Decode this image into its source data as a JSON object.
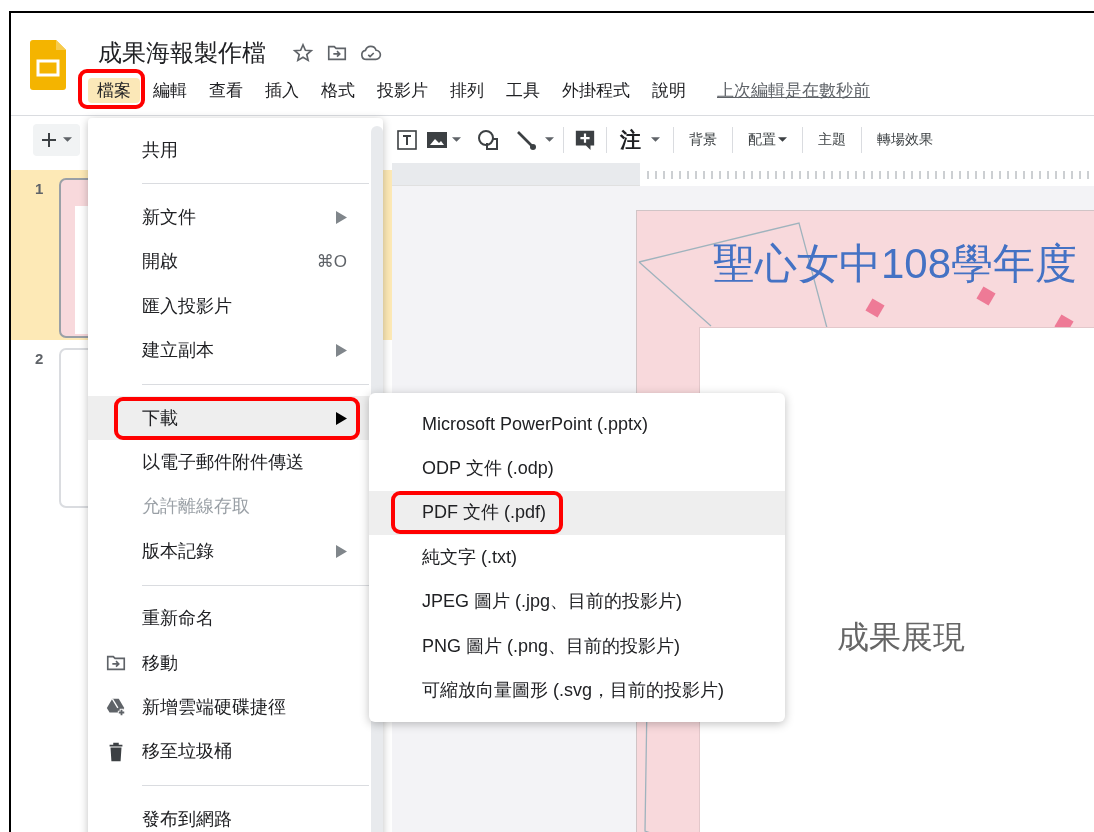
{
  "app": {
    "title": "成果海報製作檔"
  },
  "menubar": [
    {
      "label": "檔案",
      "selected": true,
      "annotated": true
    },
    {
      "label": "編輯",
      "selected": false,
      "annotated": false
    },
    {
      "label": "查看",
      "selected": false,
      "annotated": false
    },
    {
      "label": "插入",
      "selected": false,
      "annotated": false
    },
    {
      "label": "格式",
      "selected": false,
      "annotated": false
    },
    {
      "label": "投影片",
      "selected": false,
      "annotated": false
    },
    {
      "label": "排列",
      "selected": false,
      "annotated": false
    },
    {
      "label": "工具",
      "selected": false,
      "annotated": false
    },
    {
      "label": "外掛程式",
      "selected": false,
      "annotated": false
    },
    {
      "label": "說明",
      "selected": false,
      "annotated": false
    }
  ],
  "last_edit": "上次編輯是在數秒前",
  "toolbar": {
    "notes_label": "注",
    "text_buttons": [
      {
        "label": "背景",
        "dropdown": false
      },
      {
        "label": "配置",
        "dropdown": true
      },
      {
        "label": "主題",
        "dropdown": false
      },
      {
        "label": "轉場效果",
        "dropdown": false
      }
    ]
  },
  "slides": [
    {
      "number": "1",
      "selected": true
    },
    {
      "number": "2",
      "selected": false
    }
  ],
  "slide": {
    "title": "聖心女中108學年度",
    "body": "成果展現"
  },
  "file_menu": {
    "sections": [
      [
        {
          "label": "共用",
          "submenu": false,
          "disabled": false,
          "selected": false,
          "annotated": false
        }
      ],
      [
        {
          "label": "新文件",
          "submenu": true,
          "disabled": false,
          "selected": false,
          "annotated": false
        },
        {
          "label": "開啟",
          "shortcut": "⌘O",
          "submenu": false,
          "disabled": false,
          "selected": false,
          "annotated": false
        },
        {
          "label": "匯入投影片",
          "submenu": false,
          "disabled": false,
          "selected": false,
          "annotated": false
        },
        {
          "label": "建立副本",
          "submenu": true,
          "disabled": false,
          "selected": false,
          "annotated": false
        }
      ],
      [
        {
          "label": "下載",
          "submenu": true,
          "disabled": false,
          "selected": true,
          "annotated": true
        },
        {
          "label": "以電子郵件附件傳送",
          "submenu": false,
          "disabled": false,
          "selected": false,
          "annotated": false
        },
        {
          "label": "允許離線存取",
          "submenu": false,
          "disabled": true,
          "selected": false,
          "annotated": false
        },
        {
          "label": "版本記錄",
          "submenu": true,
          "disabled": false,
          "selected": false,
          "annotated": false
        }
      ],
      [
        {
          "label": "重新命名",
          "submenu": false,
          "disabled": false,
          "selected": false,
          "annotated": false
        },
        {
          "label": "移動",
          "submenu": false,
          "disabled": false,
          "selected": false,
          "annotated": false
        },
        {
          "label": "新增雲端硬碟捷徑",
          "submenu": false,
          "disabled": false,
          "selected": false,
          "annotated": false
        },
        {
          "label": "移至垃圾桶",
          "submenu": false,
          "disabled": false,
          "selected": false,
          "annotated": false
        }
      ],
      [
        {
          "label": "發布到網路",
          "submenu": false,
          "disabled": false,
          "selected": false,
          "annotated": false
        }
      ]
    ]
  },
  "download_menu": {
    "items": [
      {
        "label": "Microsoft PowerPoint (.pptx)",
        "selected": false,
        "annotated": false
      },
      {
        "label": "ODP 文件 (.odp)",
        "selected": false,
        "annotated": false
      },
      {
        "label": "PDF 文件 (.pdf)",
        "selected": true,
        "annotated": true
      },
      {
        "label": "純文字 (.txt)",
        "selected": false,
        "annotated": false
      },
      {
        "label": "JPEG 圖片 (.jpg、目前的投影片)",
        "selected": false,
        "annotated": false
      },
      {
        "label": "PNG 圖片 (.png、目前的投影片)",
        "selected": false,
        "annotated": false
      },
      {
        "label": "可縮放向量圖形 (.svg，目前的投影片)",
        "selected": false,
        "annotated": false
      }
    ]
  }
}
